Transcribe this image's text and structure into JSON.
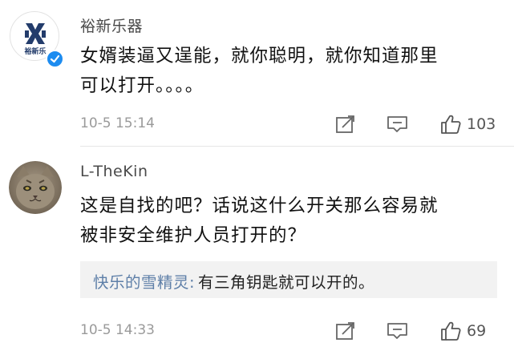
{
  "comments": [
    {
      "username": "裕新乐器",
      "avatar_text": "裕新乐",
      "verified": true,
      "content_lines": [
        "女婿装逼又逞能，就你聪明，就你知道那里",
        "可以打开。。。。"
      ],
      "timestamp": "10-5 15:14",
      "likes": "103"
    },
    {
      "username": "L-TheKin",
      "verified": false,
      "content_lines": [
        "这是自找的吧？话说这什么开关那么容易就",
        "被非安全维护人员打开的？"
      ],
      "reply": {
        "username": "快乐的雪精灵",
        "separator": ": ",
        "text": "有三角钥匙就可以开的。"
      },
      "timestamp": "10-5 14:33",
      "likes": "69"
    }
  ],
  "icons": {
    "share": "share-icon",
    "comment": "comment-icon",
    "like": "thumbs-up-icon",
    "verified": "verified-badge-icon"
  },
  "colors": {
    "verified_blue": "#1d8cf0",
    "reply_username": "#5e7fa8",
    "brand_logo": "#233c6b"
  }
}
